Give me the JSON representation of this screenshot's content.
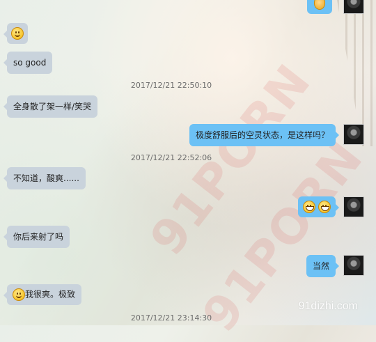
{
  "messages": {
    "m1_text": "so good",
    "m2_text": "全身散了架一样/笑哭",
    "m3_text": "极度舒服后的空灵状态，是这样吗？",
    "m4_text": "不知道，酸爽......",
    "m5_text": "你后来射了吗",
    "m6_text": "当然",
    "m7_text": "我很爽。极致"
  },
  "timestamps": {
    "t1": "2017/12/21 22:50:10",
    "t2": "2017/12/21 22:52:06",
    "t3": "2017/12/21 23:14:30"
  },
  "watermarks": {
    "wm1": "91PORN",
    "wm2": "91PORN",
    "site": "91dizhi.com"
  },
  "colors": {
    "incoming_bubble": "#c9d3dc",
    "outgoing_bubble": "#6cc1f5"
  },
  "icons": [
    "smile-emoji-icon",
    "grin-emoji-icon",
    "ok-hand-emoji-icon",
    "user-avatar"
  ]
}
